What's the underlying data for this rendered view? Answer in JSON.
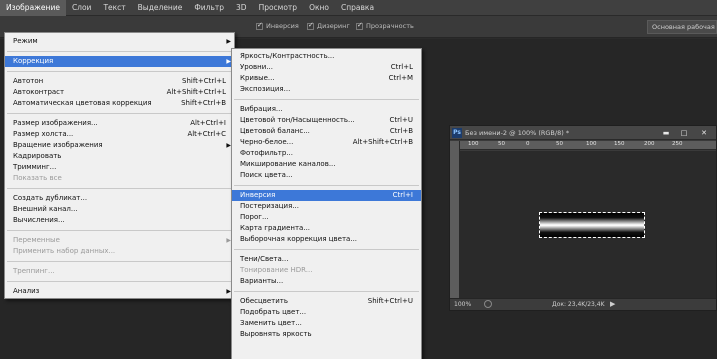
{
  "menubar": {
    "items": [
      "Изображение",
      "Слои",
      "Текст",
      "Выделение",
      "Фильтр",
      "3D",
      "Просмотр",
      "Окно",
      "Справка"
    ],
    "active_index": 0
  },
  "optionsbar": {
    "inversion_label": "Инверсия",
    "dither_label": "Дизеринг",
    "transparency_label": "Прозрачность",
    "workspace": "Основная рабочая с"
  },
  "main_menu": {
    "mode": "Режим",
    "correction": "Коррекция",
    "autotone": {
      "label": "Автотон",
      "shortcut": "Shift+Ctrl+L"
    },
    "autocontrast": {
      "label": "Автоконтраст",
      "shortcut": "Alt+Shift+Ctrl+L"
    },
    "autocolor": {
      "label": "Автоматическая цветовая коррекция",
      "shortcut": "Shift+Ctrl+B"
    },
    "image_size": {
      "label": "Размер изображения...",
      "shortcut": "Alt+Ctrl+I"
    },
    "canvas_size": {
      "label": "Размер холста...",
      "shortcut": "Alt+Ctrl+C"
    },
    "rotation": "Вращение изображения",
    "crop": "Кадрировать",
    "trim": "Тримминг...",
    "reveal_all": "Показать все",
    "duplicate": "Создать дубликат...",
    "apply_image": "Внешний канал...",
    "calculations": "Вычисления...",
    "variables": "Переменные",
    "apply_dataset": "Применить набор данных...",
    "trapping": "Треппинг...",
    "analysis": "Анализ"
  },
  "sub_menu": {
    "brightness": "Яркость/Контрастность...",
    "levels": {
      "label": "Уровни...",
      "shortcut": "Ctrl+L"
    },
    "curves": {
      "label": "Кривые...",
      "shortcut": "Ctrl+M"
    },
    "exposure": "Экспозиция...",
    "vibrance": "Вибрация...",
    "hue_sat": {
      "label": "Цветовой тон/Насыщенность...",
      "shortcut": "Ctrl+U"
    },
    "color_balance": {
      "label": "Цветовой баланс...",
      "shortcut": "Ctrl+B"
    },
    "bw": {
      "label": "Черно-белое...",
      "shortcut": "Alt+Shift+Ctrl+B"
    },
    "photo_filter": "Фотофильтр...",
    "channel_mixer": "Микширование каналов...",
    "color_lookup": "Поиск цвета...",
    "invert": {
      "label": "Инверсия",
      "shortcut": "Ctrl+I"
    },
    "posterize": "Постеризация...",
    "threshold": "Порог...",
    "gradient_map": "Карта градиента...",
    "selective_color": "Выборочная коррекция цвета...",
    "shadows": "Тени/Света...",
    "hdr": "Тонирование HDR...",
    "variations": "Варианты...",
    "desaturate": {
      "label": "Обесцветить",
      "shortcut": "Shift+Ctrl+U"
    },
    "match_color": "Подобрать цвет...",
    "replace_color": "Заменить цвет...",
    "equalize": "Выровнять яркость"
  },
  "document": {
    "icon": "Ps",
    "title": "Без имени-2 @ 100% (RGB/8) *",
    "ruler_ticks": [
      "100",
      "50",
      "0",
      "50",
      "100",
      "150",
      "200",
      "250"
    ],
    "zoom": "100%",
    "doc_size": "Док: 23,4K/23,4K"
  }
}
